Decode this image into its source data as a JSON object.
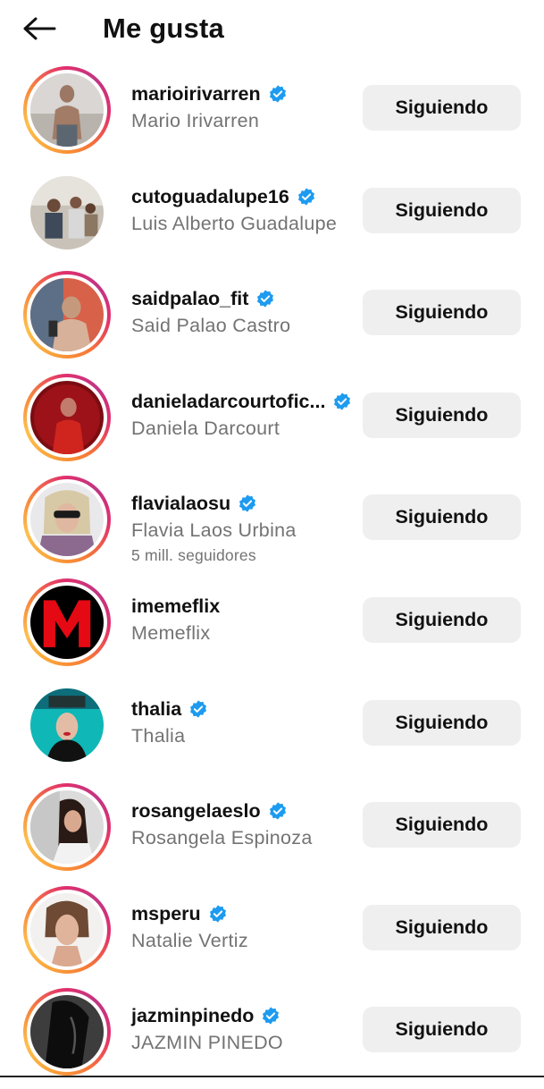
{
  "header": {
    "title": "Me gusta",
    "back_icon": "arrow-left-icon"
  },
  "colors": {
    "verified_badge": "#1d9bf0",
    "button_bg": "#efefef",
    "secondary_text": "#737373",
    "story_ring_start": "#f9a13a",
    "story_ring_end": "#c13584"
  },
  "users": [
    {
      "username": "marioirivarren",
      "full_name": "Mario Irivarren",
      "verified": true,
      "button": "Siguiendo",
      "story_ring": true,
      "followers": ""
    },
    {
      "username": "cutoguadalupe16",
      "full_name": "Luis Alberto Guadalupe",
      "verified": true,
      "button": "Siguiendo",
      "story_ring": false,
      "followers": ""
    },
    {
      "username": "saidpalao_fit",
      "full_name": "Said Palao Castro",
      "verified": true,
      "button": "Siguiendo",
      "story_ring": true,
      "followers": ""
    },
    {
      "username": "danieladarcourtofic...",
      "full_name": "Daniela Darcourt",
      "verified": true,
      "button": "Siguiendo",
      "story_ring": true,
      "followers": ""
    },
    {
      "username": "flavialaosu",
      "full_name": "Flavia Laos Urbina",
      "verified": true,
      "button": "Siguiendo",
      "story_ring": true,
      "followers": "5 mill. seguidores"
    },
    {
      "username": "imemeflix",
      "full_name": "Memeflix",
      "verified": false,
      "button": "Siguiendo",
      "story_ring": true,
      "followers": ""
    },
    {
      "username": "thalia",
      "full_name": "Thalia",
      "verified": true,
      "button": "Siguiendo",
      "story_ring": false,
      "followers": ""
    },
    {
      "username": "rosangelaeslo",
      "full_name": "Rosangela Espinoza",
      "verified": true,
      "button": "Siguiendo",
      "story_ring": true,
      "followers": ""
    },
    {
      "username": "msperu",
      "full_name": "Natalie Vertiz",
      "verified": true,
      "button": "Siguiendo",
      "story_ring": true,
      "followers": ""
    },
    {
      "username": "jazminpinedo",
      "full_name": "JAZMIN PINEDO",
      "verified": true,
      "button": "Siguiendo",
      "story_ring": true,
      "followers": ""
    }
  ]
}
